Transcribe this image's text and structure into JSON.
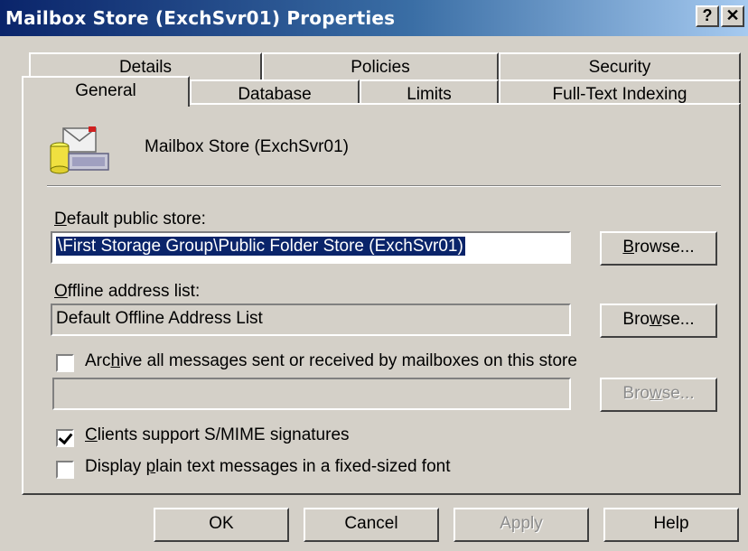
{
  "window": {
    "title": "Mailbox Store (ExchSvr01) Properties",
    "help_button": "?",
    "close_button": "✕"
  },
  "tabs": {
    "back_row": [
      "Details",
      "Policies",
      "Security"
    ],
    "front_row": [
      "General",
      "Database",
      "Limits",
      "Full-Text Indexing"
    ],
    "active": "General"
  },
  "general": {
    "store_name": "Mailbox Store (ExchSvr01)",
    "default_public_store": {
      "label": "Default public store:",
      "value": "\\First Storage Group\\Public Folder Store (ExchSvr01)",
      "browse_label": "Browse..."
    },
    "offline_address_list": {
      "label": "Offline address list:",
      "value": "Default Offline Address List",
      "browse_label": "Browse..."
    },
    "archive": {
      "label": "Archive all messages sent or received by mailboxes on this store",
      "checked": false,
      "value": "",
      "browse_label": "Browse..."
    },
    "smime": {
      "label": "Clients support S/MIME signatures",
      "checked": true
    },
    "plain_text": {
      "label": "Display plain text messages in a fixed-sized font",
      "checked": false
    }
  },
  "footer": {
    "ok": "OK",
    "cancel": "Cancel",
    "apply": "Apply",
    "help": "Help"
  }
}
